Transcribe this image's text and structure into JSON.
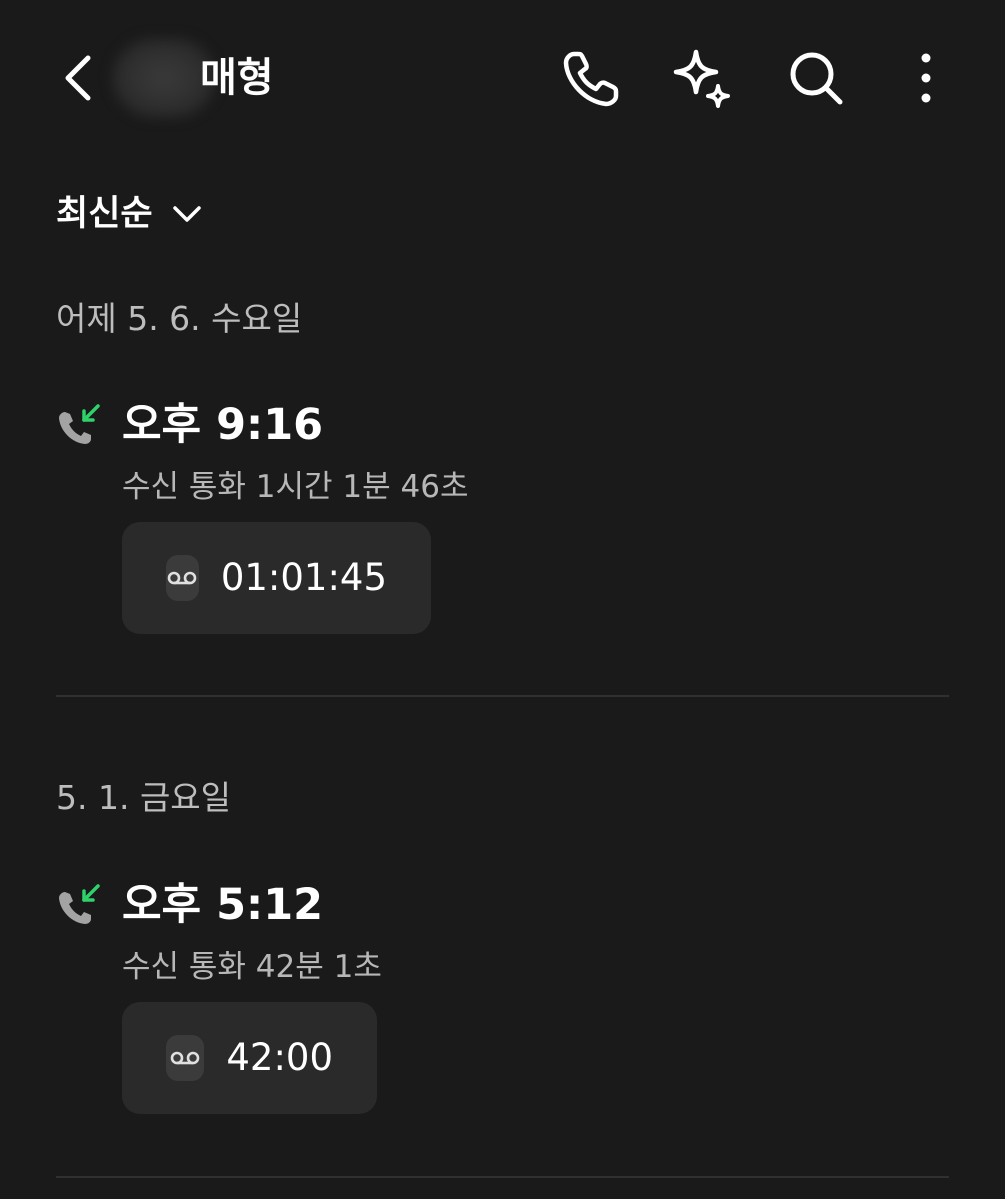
{
  "header": {
    "contact_name": "매형",
    "icons": [
      "back-icon",
      "phone-icon",
      "sparkle-icon",
      "search-icon",
      "more-vertical-icon"
    ]
  },
  "sort": {
    "label": "최신순"
  },
  "sections": [
    {
      "date": "어제 5. 6. 수요일",
      "calls": [
        {
          "type": "incoming",
          "time": "오후 9:16",
          "detail": "수신 통화 1시간 1분 46초",
          "recording_duration": "01:01:45"
        }
      ]
    },
    {
      "date": "5. 1. 금요일",
      "calls": [
        {
          "type": "incoming",
          "time": "오후 5:12",
          "detail": "수신 통화 42분 1초",
          "recording_duration": "42:00"
        }
      ]
    }
  ],
  "colors": {
    "background": "#1a1a1a",
    "incoming_arrow": "#2fd16b",
    "recording_box": "#2a2a2a"
  }
}
